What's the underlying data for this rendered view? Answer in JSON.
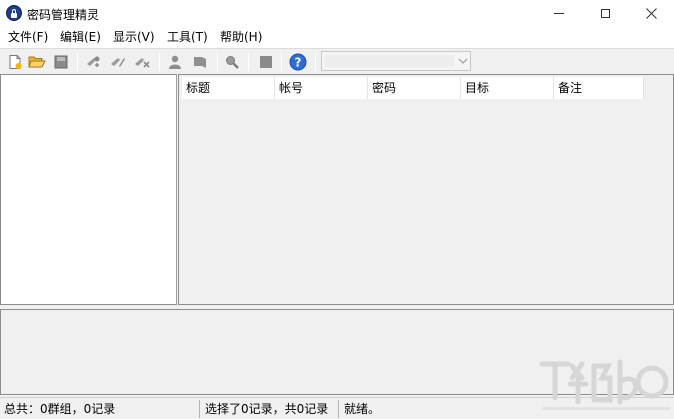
{
  "window": {
    "title": "密码管理精灵",
    "icon": "lock-icon"
  },
  "menu": {
    "file": "文件(F)",
    "edit": "编辑(E)",
    "view": "显示(V)",
    "tools": "工具(T)",
    "help": "帮助(H)"
  },
  "toolbar": {
    "icons": [
      "new-file-icon",
      "open-folder-icon",
      "save-icon",
      "group-add-icon",
      "group-edit-icon",
      "group-delete-icon",
      "record-add-icon",
      "record-edit-icon",
      "search-icon",
      "stop-icon",
      "help-icon"
    ],
    "combo_value": ""
  },
  "list": {
    "columns": [
      "标题",
      "帐号",
      "密码",
      "目标",
      "备注"
    ]
  },
  "status": {
    "total": "总共：0群组，0记录",
    "selected": "选择了0记录，共0记录",
    "ready": "就绪。"
  },
  "colors": {
    "accent_icon": "#1f3d8a",
    "help_icon": "#2b6fd6",
    "panel_bg": "#f0f0f0"
  }
}
